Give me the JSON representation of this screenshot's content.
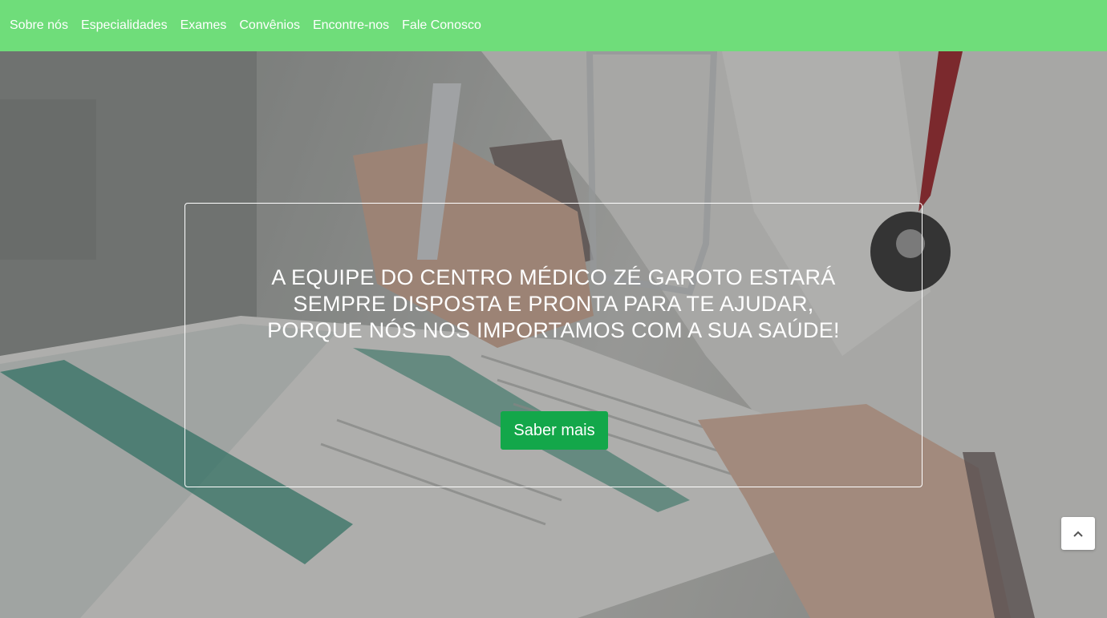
{
  "nav": {
    "items": [
      {
        "label": "Sobre nós"
      },
      {
        "label": "Especialidades"
      },
      {
        "label": "Exames"
      },
      {
        "label": "Convênios"
      },
      {
        "label": "Encontre-nos"
      },
      {
        "label": "Fale Conosco"
      }
    ]
  },
  "hero": {
    "headline": "A EQUIPE DO CENTRO MÉDICO ZÉ GAROTO ESTARÁ SEMPRE DISPOSTA E PRONTA PARA TE AJUDAR, PORQUE NÓS NOS IMPORTAMOS COM A SUA SAÚDE!",
    "button_label": "Saber mais"
  },
  "icons": {
    "scroll_top": "chevron-up-icon"
  },
  "colors": {
    "navbar": "#6fdd7a",
    "button": "#13a74a"
  }
}
